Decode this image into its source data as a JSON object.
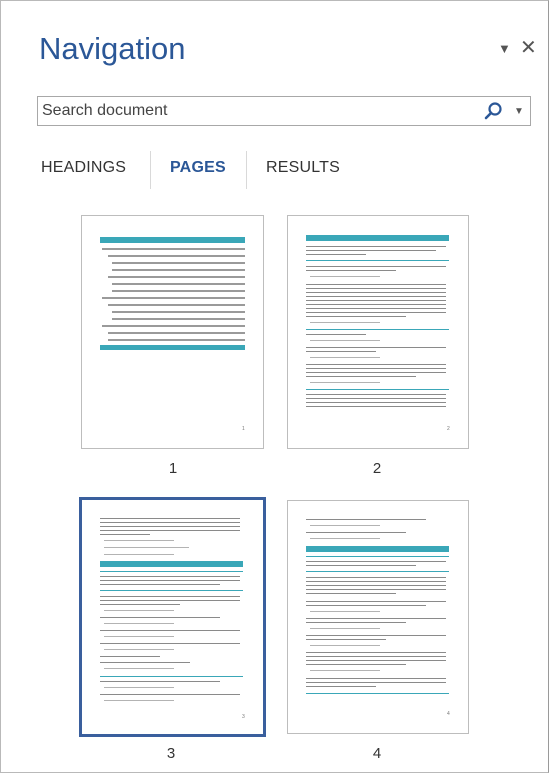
{
  "pane": {
    "title": "Navigation",
    "dropdown_icon": "chevron-down-icon",
    "close_icon": "close-icon"
  },
  "search": {
    "placeholder": "Search document",
    "icon": "search-icon"
  },
  "tabs": [
    {
      "label": "HEADINGS",
      "active": false
    },
    {
      "label": "PAGES",
      "active": true
    },
    {
      "label": "RESULTS",
      "active": false
    }
  ],
  "pages": [
    {
      "number": "1",
      "selected": false
    },
    {
      "number": "2",
      "selected": false
    },
    {
      "number": "3",
      "selected": true
    },
    {
      "number": "4",
      "selected": false
    }
  ],
  "colors": {
    "accent": "#2b5797",
    "teal_heading": "#3aa7b8",
    "selection_border": "#3a5f9d"
  }
}
